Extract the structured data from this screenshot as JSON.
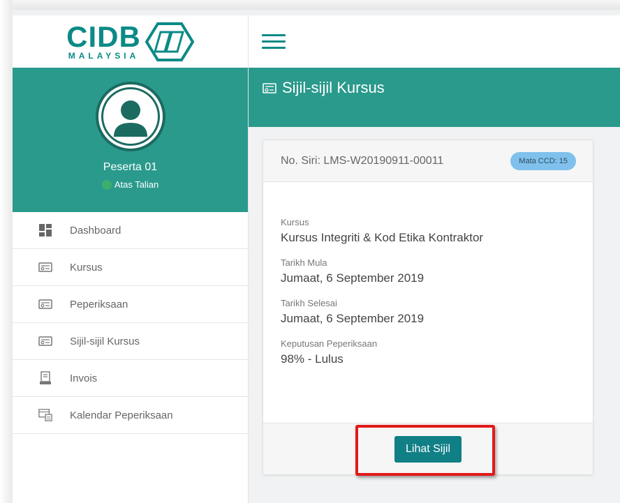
{
  "brand": {
    "logo_text": "CIDB",
    "logo_subtext": "MALAYSIA"
  },
  "profile": {
    "name": "Peserta 01",
    "status": "Atas Talian"
  },
  "sidebar": {
    "items": [
      {
        "label": "Dashboard",
        "icon": "dashboard-icon"
      },
      {
        "label": "Kursus",
        "icon": "certificate-icon"
      },
      {
        "label": "Peperiksaan",
        "icon": "certificate-icon"
      },
      {
        "label": "Sijil-sijil Kursus",
        "icon": "certificate-icon"
      },
      {
        "label": "Invois",
        "icon": "invoice-icon"
      },
      {
        "label": "Kalendar Peperiksaan",
        "icon": "calendar-icon"
      }
    ]
  },
  "header": {
    "title": "Sijil-sijil Kursus",
    "title_icon": "certificate-icon"
  },
  "card": {
    "serial": "No. Siri: LMS-W20190911-00011",
    "badge": "Mata CCD: 15",
    "fields": [
      {
        "label": "Kursus",
        "value": "Kursus Integriti & Kod Etika Kontraktor"
      },
      {
        "label": "Tarikh Mula",
        "value": "Jumaat, 6 September 2019"
      },
      {
        "label": "Tarikh Selesai",
        "value": "Jumaat, 6 September 2019"
      },
      {
        "label": "Keputusan Peperiksaan",
        "value": "98% - Lulus"
      }
    ],
    "button_label": "Lihat Sijil"
  },
  "colors": {
    "brand_teal": "#2a9a8c",
    "logo_teal": "#0b8a86",
    "button_teal": "#117f86",
    "badge_blue": "#7fc1ec",
    "highlight_red": "#e21a1a"
  }
}
